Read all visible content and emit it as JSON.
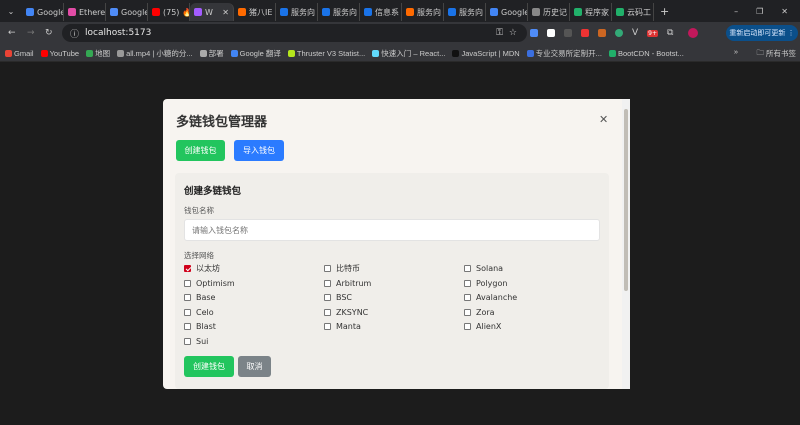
{
  "browser": {
    "tabs": [
      {
        "label": "Google",
        "color": "#4285f4"
      },
      {
        "label": "Ethere",
        "color": "#e24ca6"
      },
      {
        "label": "Google",
        "color": "#4f8cf7"
      },
      {
        "label": "(75) 🔥",
        "color": "#ff0000"
      },
      {
        "label": "W",
        "color": "#a35cff",
        "active": true
      },
      {
        "label": "猪八IE",
        "color": "#ff6a00"
      },
      {
        "label": "服务向",
        "color": "#1a73e8"
      },
      {
        "label": "服务向",
        "color": "#1a73e8"
      },
      {
        "label": "信息系",
        "color": "#1a73e8"
      },
      {
        "label": "服务向",
        "color": "#ff6a00"
      },
      {
        "label": "服务向",
        "color": "#1a73e8"
      },
      {
        "label": "Google",
        "color": "#4285f4"
      },
      {
        "label": "历史记",
        "color": "#888888"
      },
      {
        "label": "程序家",
        "color": "#21b06a"
      },
      {
        "label": "云码工",
        "color": "#21b06a"
      }
    ],
    "url": "localhost:5173",
    "update_button": "重新启动即可更新",
    "badge": "9+",
    "bookmarks": [
      {
        "label": "Gmail",
        "color": "#ea4335"
      },
      {
        "label": "YouTube",
        "color": "#ff0000"
      },
      {
        "label": "地图",
        "color": "#34a853"
      },
      {
        "label": "all.mp4 | 小糖的分...",
        "color": "#999999"
      },
      {
        "label": "部署",
        "color": "#aaaaaa"
      },
      {
        "label": "Google 翻译",
        "color": "#4285f4"
      },
      {
        "label": "Thruster V3 Statist...",
        "color": "#b5e61d"
      },
      {
        "label": "快速入门 – React...",
        "color": "#61dafb"
      },
      {
        "label": "JavaScript | MDN",
        "color": "#111111"
      },
      {
        "label": "专业交易所定制开...",
        "color": "#3b6fe0"
      },
      {
        "label": "BootCDN - Bootst...",
        "color": "#21b06a"
      }
    ],
    "all_bookmarks": "所有书签"
  },
  "modal": {
    "title": "多链钱包管理器",
    "create_tab": "创建钱包",
    "import_tab": "导入钱包",
    "panel_title": "创建多链钱包",
    "name_label": "钱包名称",
    "name_placeholder": "请输入钱包名称",
    "name_value": "",
    "network_label": "选择网络",
    "networks": [
      {
        "label": "以太坊",
        "checked": true
      },
      {
        "label": "比特币",
        "checked": false
      },
      {
        "label": "Solana",
        "checked": false
      },
      {
        "label": "Optimism",
        "checked": false
      },
      {
        "label": "Arbitrum",
        "checked": false
      },
      {
        "label": "Polygon",
        "checked": false
      },
      {
        "label": "Base",
        "checked": false
      },
      {
        "label": "BSC",
        "checked": false
      },
      {
        "label": "Avalanche",
        "checked": false
      },
      {
        "label": "Celo",
        "checked": false
      },
      {
        "label": "ZKSYNC",
        "checked": false
      },
      {
        "label": "Zora",
        "checked": false
      },
      {
        "label": "Blast",
        "checked": false
      },
      {
        "label": "Manta",
        "checked": false
      },
      {
        "label": "AlienX",
        "checked": false
      },
      {
        "label": "Sui",
        "checked": false
      }
    ],
    "submit": "创建钱包",
    "cancel": "取消",
    "colors": {
      "green": "#22c55e",
      "blue": "#2b7bff",
      "gray": "#7b8388",
      "check": "#d0021b"
    }
  }
}
